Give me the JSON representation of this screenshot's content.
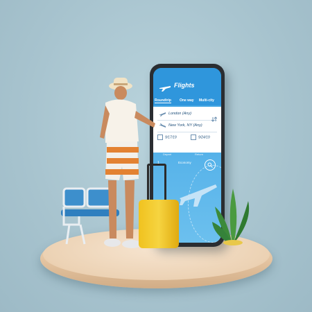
{
  "app": {
    "title": "Flights",
    "tabs": [
      "Roundtrip",
      "One way",
      "Multi-city"
    ],
    "active_tab": 0,
    "from": "London (Any)",
    "to": "New York, NY (Any)",
    "depart_date": "9/17/19",
    "return_date": "9/24/19",
    "depart_caption": "Depart",
    "return_caption": "Return",
    "passengers_glyphs": "1",
    "cabin": "Economy"
  },
  "icons": [
    "plane-icon",
    "swap-icon",
    "calendar-icon",
    "search-icon",
    "plane-illustration-icon"
  ],
  "colors": {
    "background": "#a9c6d1",
    "screen_blue": "#3a9fe0",
    "suitcase_yellow": "#f2c21f",
    "platform": "#ecd2b4"
  }
}
